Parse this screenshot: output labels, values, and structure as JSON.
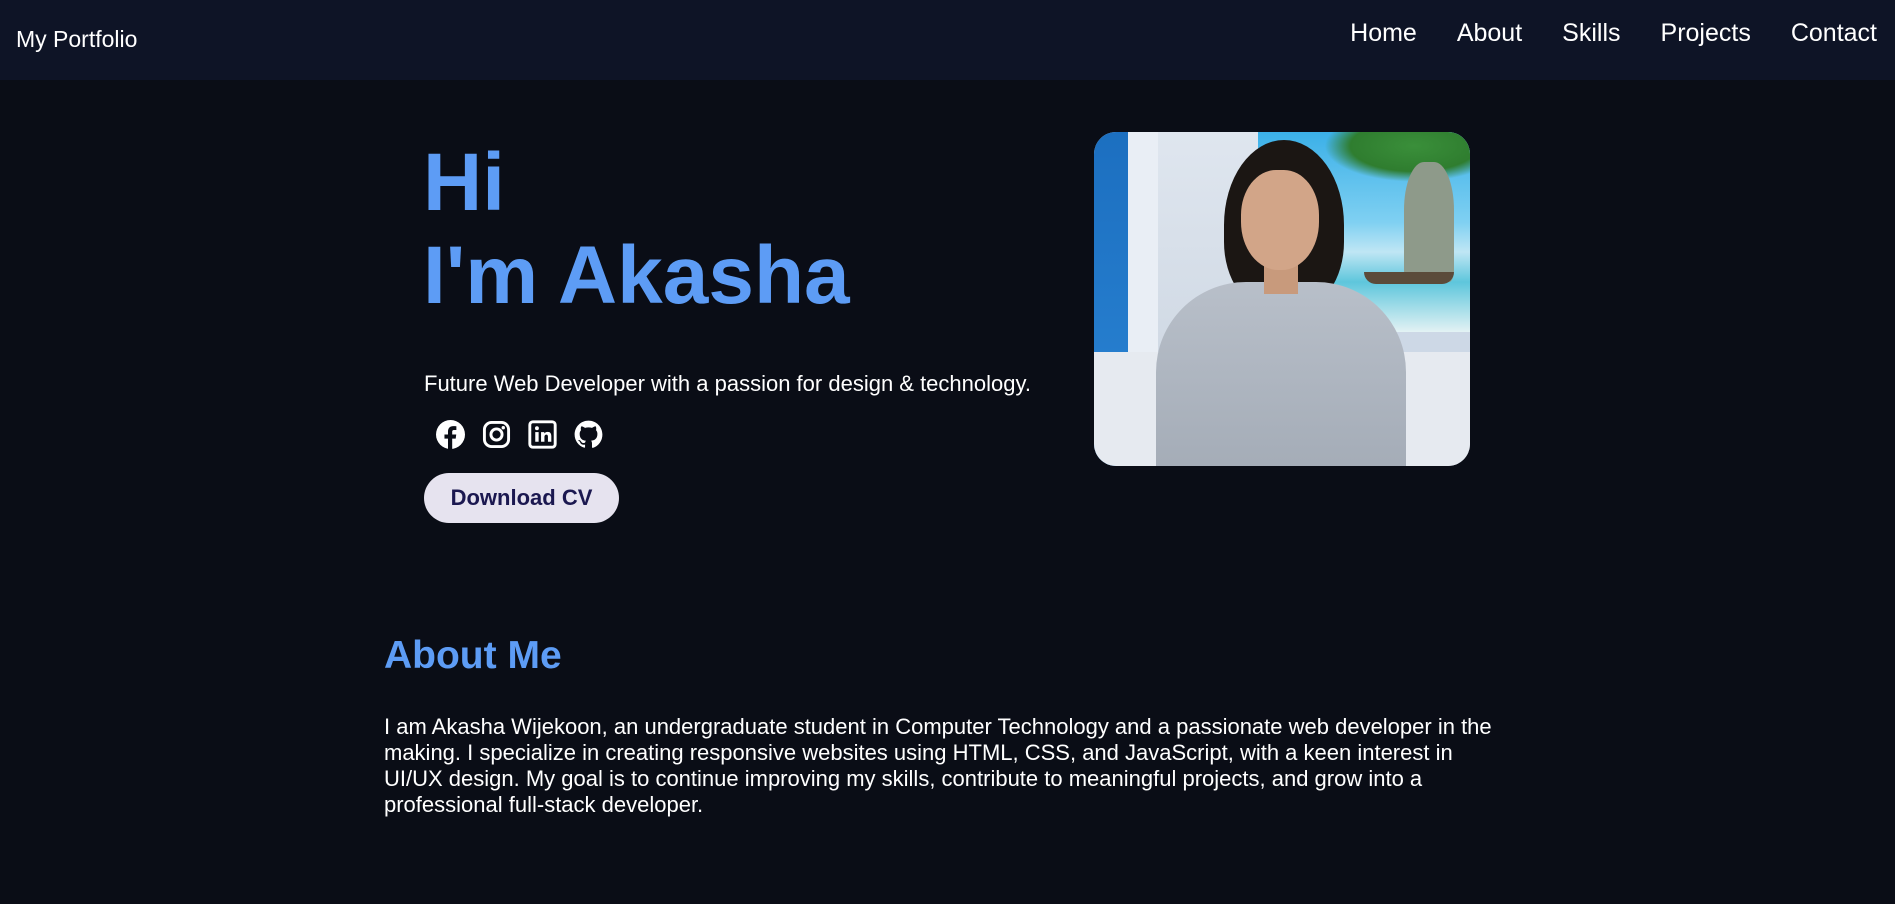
{
  "navbar": {
    "brand": "My Portfolio",
    "links": [
      "Home",
      "About",
      "Skills",
      "Projects",
      "Contact"
    ]
  },
  "hero": {
    "greeting": "Hi",
    "name_line": "I'm Akasha",
    "subtitle": "Future Web Developer with a passion for design & technology.",
    "socials": [
      "facebook-icon",
      "instagram-icon",
      "linkedin-icon",
      "github-icon"
    ],
    "cv_button": "Download CV"
  },
  "about": {
    "title": "About Me",
    "text": "I am Akasha Wijekoon, an undergraduate student in Computer Technology and a passionate web developer in the making. I specialize in creating responsive websites using HTML, CSS, and JavaScript, with a keen interest in UI/UX design. My goal is to continue improving my skills, contribute to meaningful projects, and grow into a professional full-stack developer."
  },
  "colors": {
    "background": "#0a0d16",
    "navbar": "#0e1426",
    "accent": "#5d9cf5",
    "button_bg": "#e6e3ef",
    "button_text": "#1b1850"
  }
}
